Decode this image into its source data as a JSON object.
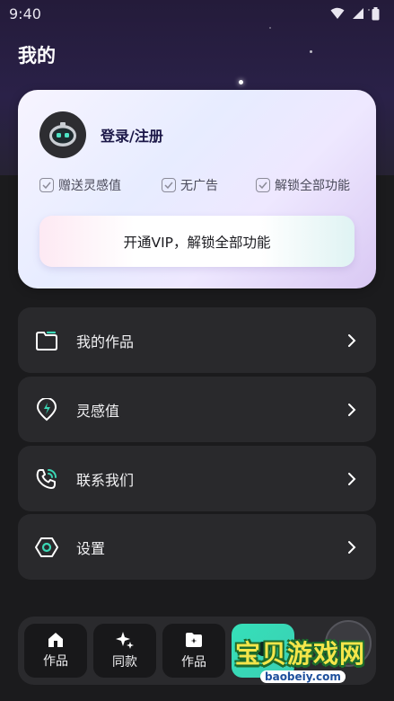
{
  "status_bar": {
    "time": "9:40"
  },
  "page": {
    "title": "我的"
  },
  "vip_card": {
    "login_label": "登录/注册",
    "perks": [
      "赠送灵感值",
      "无广告",
      "解锁全部功能"
    ],
    "cta_label": "开通VIP，解锁全部功能"
  },
  "menu": [
    {
      "label": "我的作品",
      "icon": "folder-icon"
    },
    {
      "label": "灵感值",
      "icon": "inspiration-points-icon"
    },
    {
      "label": "联系我们",
      "icon": "phone-icon"
    },
    {
      "label": "设置",
      "icon": "settings-icon"
    }
  ],
  "bottom_nav": [
    {
      "label": "作品",
      "icon": "home-icon"
    },
    {
      "label": "同款",
      "icon": "sparkle-icon"
    },
    {
      "label": "作品",
      "icon": "creation-icon"
    },
    {
      "label": "",
      "icon": "active-tab-icon"
    }
  ],
  "watermark": {
    "text": "宝贝游戏网",
    "url": "baobeiy.com"
  },
  "colors": {
    "accent": "#3bd7b5",
    "background": "#1b1b1d",
    "card": "#29292c"
  }
}
